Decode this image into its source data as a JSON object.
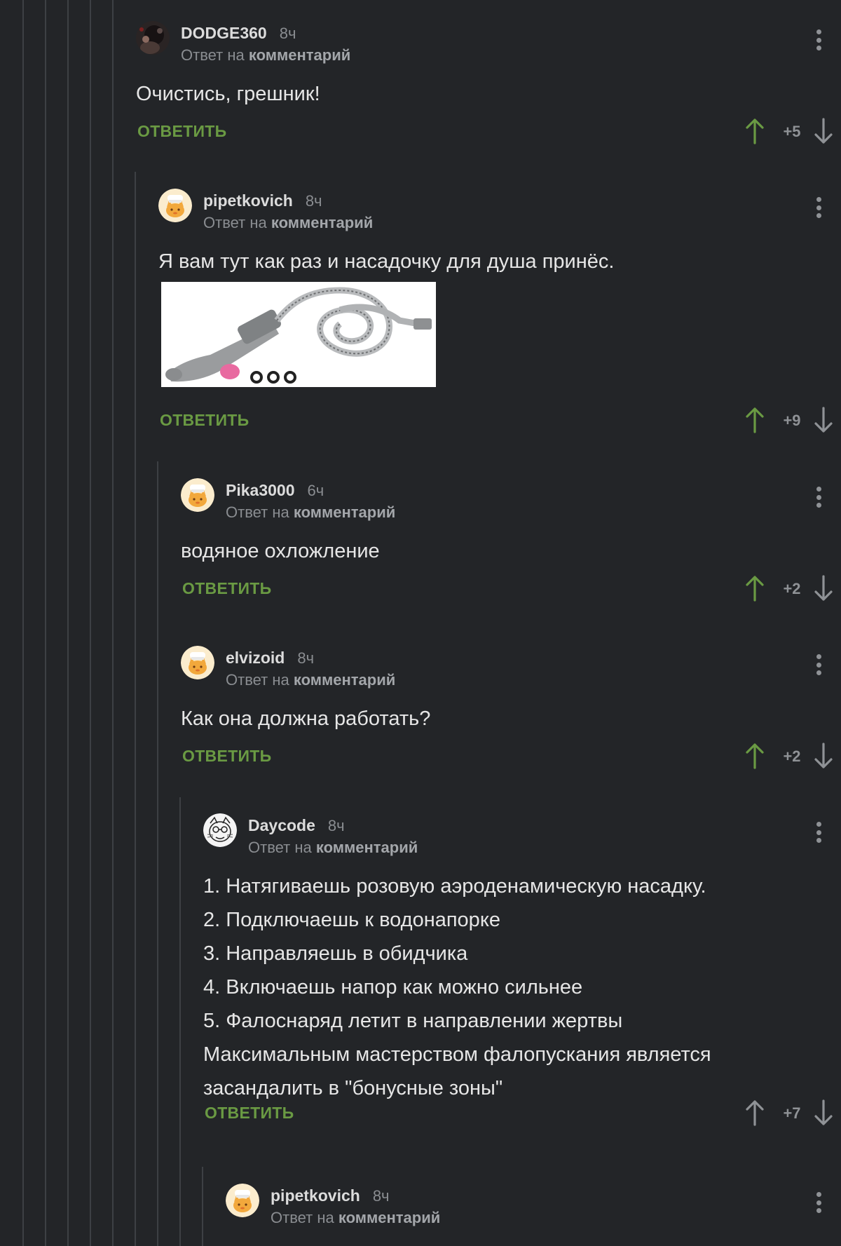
{
  "labels": {
    "reply_to_prefix": "Ответ на",
    "reply_to_target": "комментарий",
    "reply_button": "ОТВЕТИТЬ"
  },
  "colors": {
    "background": "#232528",
    "accent_green": "#6a9a43",
    "muted_text": "#8a8d91"
  },
  "comments": [
    {
      "author": "DODGE360",
      "time": "8ч",
      "avatar": "dark-photo-avatar",
      "text": [
        "Очистись, грешник!"
      ],
      "score": "+5",
      "upvoted": true
    },
    {
      "author": "pipetkovich",
      "time": "8ч",
      "avatar": "default-cat-avatar",
      "text": [
        "Я вам тут как раз и насадочку для душа принёс."
      ],
      "has_image": true,
      "score": "+9",
      "upvoted": true
    },
    {
      "author": "Pika3000",
      "time": "6ч",
      "avatar": "default-cat-avatar",
      "text": [
        "водяное охложление"
      ],
      "score": "+2",
      "upvoted": true
    },
    {
      "author": "elvizoid",
      "time": "8ч",
      "avatar": "default-cat-avatar",
      "text": [
        "Как она должна работать?"
      ],
      "score": "+2",
      "upvoted": true
    },
    {
      "author": "Daycode",
      "time": "8ч",
      "avatar": "sketch-avatar",
      "text": [
        "1. Натягиваешь розовую аэроденамическую насадку.",
        "2. Подключаешь к водонапорке",
        "3. Направляешь в обидчика",
        "4. Включаешь напор как можно сильнее",
        "5. Фалоснаряд летит в направлении жертвы",
        "Максимальным мастерством фалопускания является",
        "засандалить в \"бонусные зоны\""
      ],
      "score": "+7",
      "upvoted": false
    },
    {
      "author": "pipetkovich",
      "time": "8ч",
      "avatar": "default-cat-avatar"
    }
  ]
}
